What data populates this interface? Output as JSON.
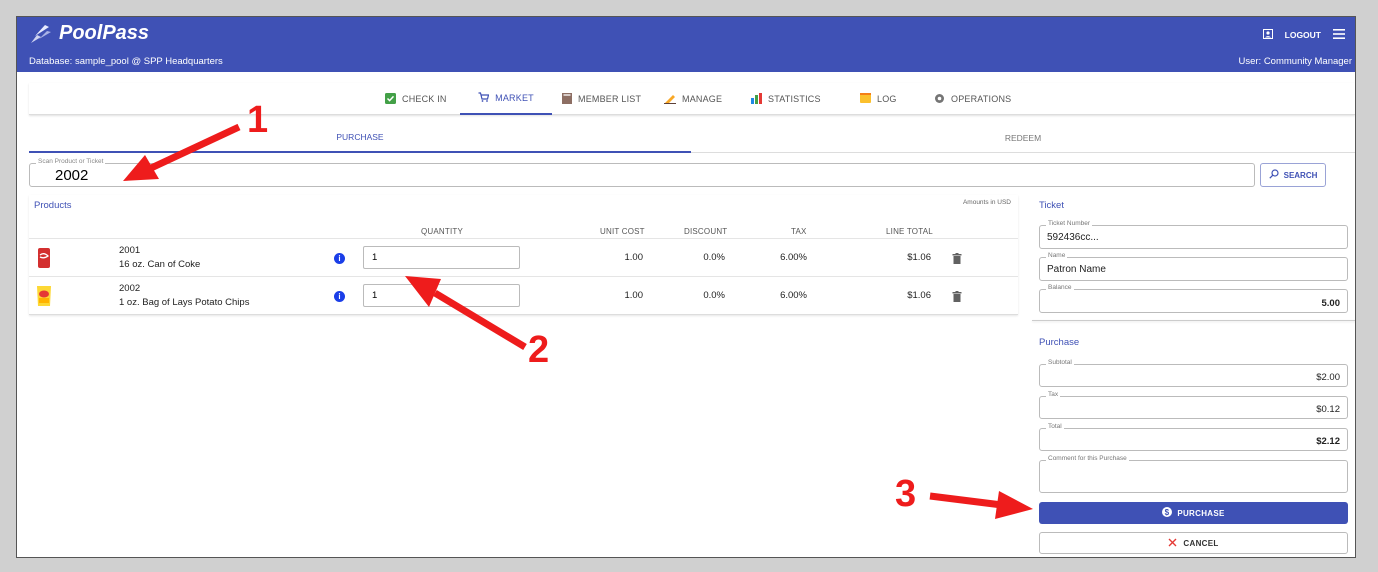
{
  "app": {
    "name": "PoolPass",
    "database": "Database: sample_pool @ SPP Headquarters",
    "user": "User: Community Manager",
    "logout": "LOGOUT"
  },
  "nav": {
    "checkin": "CHECK IN",
    "market": "MARKET",
    "memberlist": "MEMBER LIST",
    "manage": "MANAGE",
    "statistics": "STATISTICS",
    "log": "LOG",
    "operations": "OPERATIONS"
  },
  "subtabs": {
    "purchase": "PURCHASE",
    "redeem": "REDEEM"
  },
  "scan": {
    "label": "Scan Product or Ticket",
    "value": "2002",
    "search": "SEARCH"
  },
  "products": {
    "title": "Products",
    "currency_note": "Amounts in USD",
    "headers": {
      "quantity": "QUANTITY",
      "unit_cost": "UNIT COST",
      "discount": "DISCOUNT",
      "tax": "TAX",
      "line_total": "LINE TOTAL"
    },
    "rows": [
      {
        "code": "2001",
        "name": "16 oz. Can of Coke",
        "quantity": "1",
        "unit_cost": "1.00",
        "discount": "0.0%",
        "tax": "6.00%",
        "line_total": "$1.06"
      },
      {
        "code": "2002",
        "name": "1 oz. Bag of Lays Potato Chips",
        "quantity": "1",
        "unit_cost": "1.00",
        "discount": "0.0%",
        "tax": "6.00%",
        "line_total": "$1.06"
      }
    ]
  },
  "ticket": {
    "title": "Ticket",
    "number_label": "Ticket Number",
    "number": "592436cc...",
    "name_label": "Name",
    "name": "Patron Name",
    "balance_label": "Balance",
    "balance": "5.00"
  },
  "purchase": {
    "title": "Purchase",
    "subtotal_label": "Subtotal",
    "subtotal": "$2.00",
    "tax_label": "Tax",
    "tax": "$0.12",
    "total_label": "Total",
    "total": "$2.12",
    "comment_label": "Comment for this Purchase",
    "purchase_button": "PURCHASE",
    "cancel_button": "CANCEL"
  },
  "callouts": {
    "one": "1",
    "two": "2",
    "three": "3"
  },
  "colors": {
    "primary": "#3f51b5",
    "callout": "#ee1c1c",
    "info": "#1a3ee8"
  }
}
